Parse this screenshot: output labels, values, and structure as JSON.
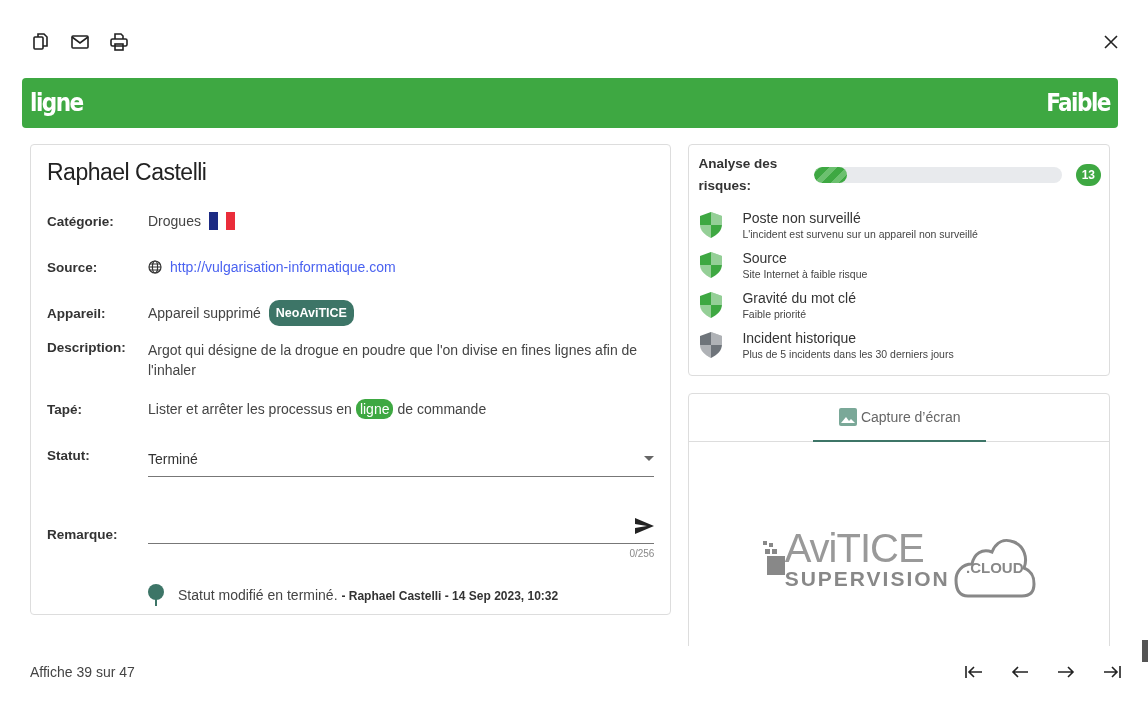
{
  "banner": {
    "keyword": "ligne",
    "risk": "Faible"
  },
  "incident": {
    "name": "Raphael Castelli",
    "fields": [
      {
        "kind": "flag",
        "label": "Catégorie:",
        "value": "Drogues"
      },
      {
        "kind": "link",
        "label": "Source:",
        "value": "http://vulgarisation-informatique.com"
      },
      {
        "kind": "device",
        "label": "Appareil:",
        "value": "Appareil supprimé",
        "badge": "NeoAviTICE"
      },
      {
        "kind": "text",
        "label": "Description:",
        "value": "Argot qui désigne de la drogue en poudre que l'on divise en fines lignes afin de l'inhaler"
      },
      {
        "kind": "typed",
        "label": "Tapé:",
        "segments": [
          {
            "text": "Lister et arrêter les processus en",
            "highlighted": false
          },
          {
            "text": "ligne",
            "highlighted": true
          },
          {
            "text": "de commande",
            "highlighted": false
          }
        ]
      },
      {
        "kind": "select",
        "label": "Statut:",
        "value": "Terminé"
      },
      {
        "kind": "remark",
        "label": "Remarque:",
        "counter": "0/256"
      }
    ],
    "history": [
      {
        "text": "Statut modifié en terminé.",
        "meta": "- Raphael Castelli - 14 Sep 2023, 10:32"
      }
    ]
  },
  "risk_analysis": {
    "label": "Analyse des risques:",
    "level": 0.13,
    "score": "13",
    "factors": [
      {
        "title": "Poste non surveillé",
        "detail": "L'incident est survenu sur un appareil non surveillé",
        "color": "#3ea842"
      },
      {
        "title": "Source",
        "detail": "Site Internet à faible risque",
        "color": "#3ea842"
      },
      {
        "title": "Gravité du mot clé",
        "detail": "Faible priorité",
        "color": "#3ea842"
      },
      {
        "title": "Incident historique",
        "detail": "Plus de 5 incidents dans les 30 derniers jours",
        "color": "#6e747a"
      }
    ]
  },
  "screenshot_panel": {
    "tabs": [
      {
        "label": "Capture d’écran",
        "selected": true
      }
    ],
    "logo": {
      "name": "AviTICE",
      "tagline": "SUPERVISION",
      "cloud": ".CLOUD"
    }
  },
  "footer": {
    "count": "Affiche 39 sur 47"
  }
}
